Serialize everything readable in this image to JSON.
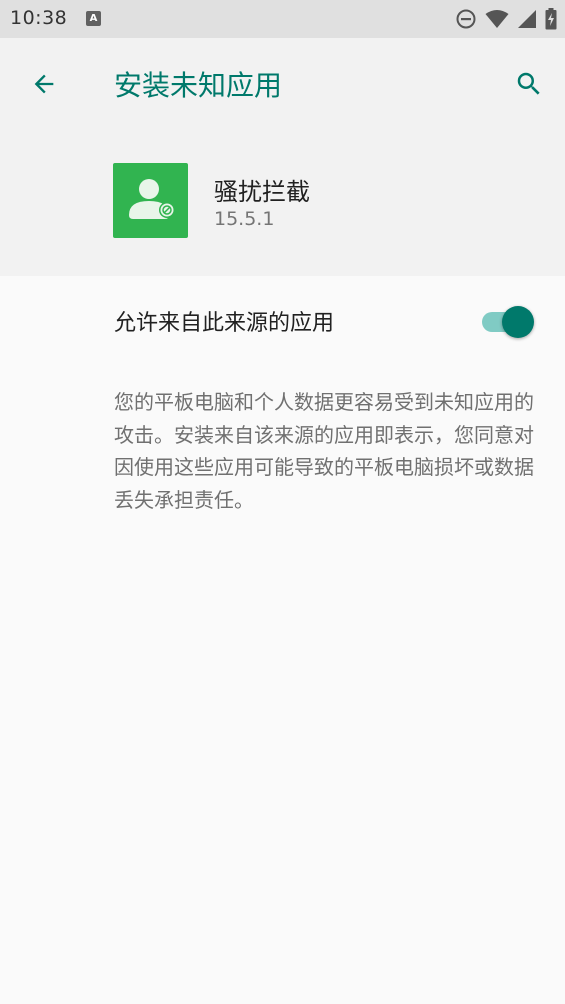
{
  "status_bar": {
    "time": "10:38",
    "notification_icon_letter": "A",
    "icons": [
      "do-not-disturb-icon",
      "wifi-icon",
      "signal-icon",
      "battery-charging-icon"
    ]
  },
  "app_bar": {
    "title": "安装未知应用",
    "back_icon": "arrow-back-icon",
    "search_icon": "search-icon"
  },
  "app_info": {
    "name": "骚扰拦截",
    "version": "15.5.1",
    "icon_color": "#31b450"
  },
  "setting": {
    "label": "允许来自此来源的应用",
    "enabled": true
  },
  "warning_text": "您的平板电脑和个人数据更容易受到未知应用的攻击。安装来自该来源的应用即表示，您同意对因使用这些应用可能导致的平板电脑损坏或数据丢失承担责任。",
  "colors": {
    "accent": "#00796b",
    "toggle_track": "#80cbc4",
    "status_bar": "#e0e0e0",
    "header_bg": "#f2f2f2",
    "body_bg": "#fafafa"
  }
}
